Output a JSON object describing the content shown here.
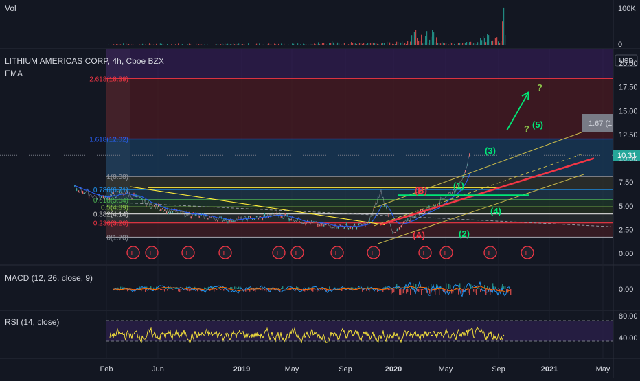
{
  "panes": {
    "volume": {
      "label": "Vol",
      "axis_ticks": [
        "100K",
        "0"
      ]
    },
    "main": {
      "title": "LITHIUM AMERICAS CORP, 4h, Cboe BZX",
      "indicator": "EMA",
      "currency": "USD",
      "price_ticks": [
        "20.00",
        "17.50",
        "15.00",
        "12.50",
        "10.00",
        "7.50",
        "5.00",
        "2.50",
        "0.00"
      ],
      "last_price": "10.31",
      "ruler_label": "1.67 (1",
      "fib_levels": [
        {
          "label": "2.618(18.39)",
          "price": 18.39,
          "color": "#f23645"
        },
        {
          "label": "1.618(12.02)",
          "price": 12.02,
          "color": "#2962ff"
        },
        {
          "label": "1(8.08)",
          "price": 8.08,
          "color": "#9598a1"
        },
        {
          "label": "0.786(6.71)",
          "price": 6.71,
          "color": "#2196f3"
        },
        {
          "label": "0.618(5.64)",
          "price": 5.64,
          "color": "#4caf50"
        },
        {
          "label": "0.5(4.89)",
          "price": 4.89,
          "color": "#8bc34a"
        },
        {
          "label": "0.382(4.14)",
          "price": 4.14,
          "color": "#c8c8c8"
        },
        {
          "label": "0.236(3.20)",
          "price": 3.2,
          "color": "#f23645"
        },
        {
          "label": "0(1.70)",
          "price": 1.7,
          "color": "#9598a1"
        }
      ],
      "wave_labels": [
        {
          "text": "(1)",
          "color": "#00e676"
        },
        {
          "text": "(2)",
          "color": "#00e676"
        },
        {
          "text": "(3)",
          "color": "#00e676"
        },
        {
          "text": "(4)",
          "color": "#00e676"
        },
        {
          "text": "(5)",
          "color": "#00e676"
        },
        {
          "text": "(A)",
          "color": "#f23645"
        },
        {
          "text": "(B)",
          "color": "#f23645"
        },
        {
          "text": "?",
          "color": "#8bc34a"
        },
        {
          "text": "?",
          "color": "#8bc34a"
        }
      ],
      "earnings_marker": "E",
      "earnings_count": 15
    },
    "macd": {
      "label": "MACD (12, 26, close, 9)",
      "axis_ticks": [
        "0.00"
      ]
    },
    "rsi": {
      "label": "RSI (14, close)",
      "axis_ticks": [
        "80.00",
        "40.00"
      ]
    }
  },
  "time_axis": [
    "Feb",
    "Jun",
    "2019",
    "May",
    "Sep",
    "2020",
    "May",
    "Sep",
    "2021",
    "May"
  ],
  "colors": {
    "background": "#131722",
    "up": "#26a69a",
    "down": "#ef5350",
    "ema": "#2962ff",
    "trend_yellow": "#ffeb3b",
    "red_line": "#f23645",
    "green_line": "#00e676",
    "rsi_line": "#ffeb3b",
    "rsi_band": "#2a1f4a",
    "macd_line": "#2196f3",
    "signal_line": "#ff6d00"
  },
  "chart_data": {
    "type": "line",
    "title": "LITHIUM AMERICAS CORP, 4h, Cboe BZX",
    "xlabel": "",
    "ylabel": "",
    "ylim": [
      0,
      20
    ],
    "x": [
      "2018-02",
      "2018-04",
      "2018-06",
      "2018-08",
      "2018-10",
      "2018-12",
      "2019-02",
      "2019-04",
      "2019-06",
      "2019-08",
      "2019-10",
      "2019-12",
      "2020-01",
      "2020-02",
      "2020-03",
      "2020-04",
      "2020-05",
      "2020-06",
      "2020-07",
      "2020-08",
      "2020-09"
    ],
    "series": [
      {
        "name": "",
        "values": [
          6.9,
          5.8,
          6.4,
          5.0,
          4.3,
          3.9,
          3.5,
          3.7,
          4.1,
          3.3,
          2.9,
          2.8,
          3.2,
          6.5,
          2.0,
          3.4,
          4.3,
          4.8,
          6.0,
          6.9,
          10.3
        ]
      }
    ],
    "volume_ylim": [
      0,
      100000
    ],
    "rsi_bands": [
      70,
      30
    ],
    "grid": true,
    "legend": "none"
  }
}
